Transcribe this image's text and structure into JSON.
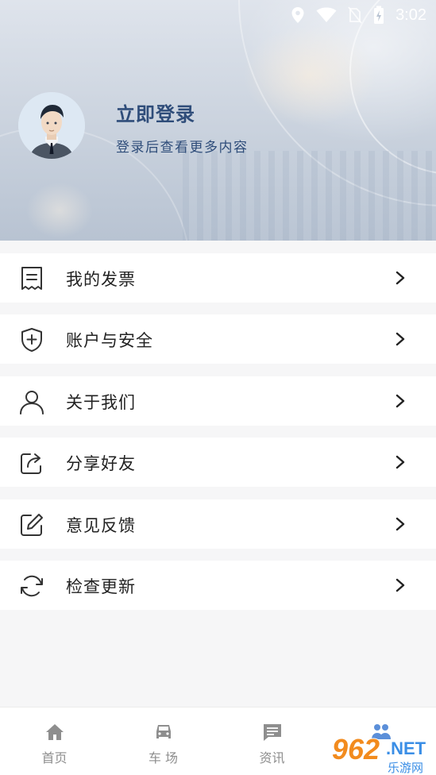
{
  "status_bar": {
    "time": "3:02",
    "icons": [
      "location-icon",
      "wifi-icon",
      "no-sim-icon",
      "battery-charging-icon"
    ]
  },
  "profile": {
    "title": "立即登录",
    "subtitle": "登录后查看更多内容",
    "avatar_icon": "user-avatar-icon"
  },
  "menu": [
    {
      "label": "我的发票",
      "icon": "invoice-icon"
    },
    {
      "label": "账户与安全",
      "icon": "shield-plus-icon"
    },
    {
      "label": "关于我们",
      "icon": "person-icon"
    },
    {
      "label": "分享好友",
      "icon": "share-icon"
    },
    {
      "label": "意见反馈",
      "icon": "edit-icon"
    },
    {
      "label": "检查更新",
      "icon": "refresh-icon"
    }
  ],
  "bottom_nav": [
    {
      "label": "首页",
      "icon": "home-icon"
    },
    {
      "label": "车 场",
      "icon": "car-icon"
    },
    {
      "label": "资讯",
      "icon": "message-icon"
    },
    {
      "label": "",
      "icon": "people-icon"
    }
  ],
  "watermark": {
    "brand": "962",
    "suffix": ".NET",
    "caption": "乐游网"
  },
  "colors": {
    "title_blue": "#2f4d7a",
    "background": "#f6f6f7",
    "nav_inactive": "#8e8e8e",
    "nav_active": "#5b8fd9"
  }
}
